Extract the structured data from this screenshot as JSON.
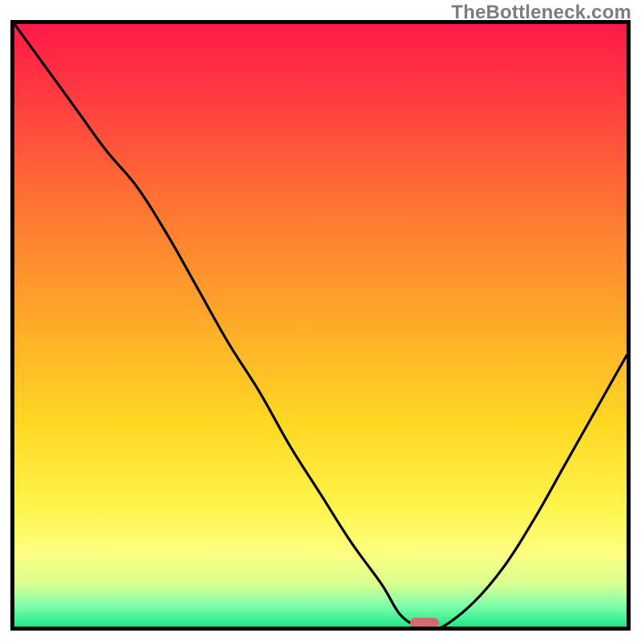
{
  "watermark": "TheBottleneck.com",
  "colors": {
    "frame_border": "#000000",
    "curve": "#000000",
    "marker_fill": "#d46a6d",
    "gradient_stops": [
      {
        "offset": 0.0,
        "color": "#ff1a49"
      },
      {
        "offset": 0.12,
        "color": "#ff3b3f"
      },
      {
        "offset": 0.3,
        "color": "#ff7433"
      },
      {
        "offset": 0.48,
        "color": "#ffa629"
      },
      {
        "offset": 0.66,
        "color": "#ffd722"
      },
      {
        "offset": 0.8,
        "color": "#fff44a"
      },
      {
        "offset": 0.88,
        "color": "#fcff82"
      },
      {
        "offset": 0.93,
        "color": "#d9ff8f"
      },
      {
        "offset": 0.965,
        "color": "#7fffaa"
      },
      {
        "offset": 1.0,
        "color": "#20e987"
      }
    ]
  },
  "chart_data": {
    "type": "line",
    "title": "",
    "xlabel": "",
    "ylabel": "",
    "xlim": [
      0,
      100
    ],
    "ylim": [
      0,
      100
    ],
    "x": [
      0,
      5,
      10,
      15,
      20,
      25,
      30,
      35,
      40,
      45,
      50,
      55,
      60,
      63,
      66,
      68,
      70,
      75,
      80,
      85,
      90,
      95,
      100
    ],
    "values": [
      100,
      93,
      86,
      79,
      73,
      65,
      56,
      47,
      39,
      30,
      22,
      14,
      7,
      2,
      0,
      0,
      0,
      4,
      10,
      18,
      27,
      36,
      45
    ],
    "marker": {
      "x": 67,
      "y": 0
    },
    "notes": "V-shaped bottleneck curve over a rainbow vertical gradient background; optimal point (minimum) occurs near x≈67% where the curve meets the x-axis, marked by a small rounded red indicator."
  },
  "layout": {
    "inner_left": 18,
    "inner_top": 30,
    "inner_width": 764,
    "inner_height": 752,
    "border_width": 5
  }
}
